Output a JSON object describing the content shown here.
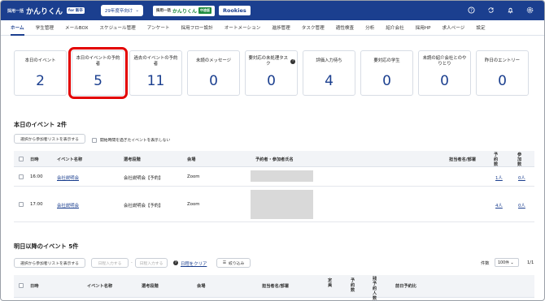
{
  "header": {
    "logo_prefix": "採用一括",
    "logo_name": "かんりくん",
    "logo_badge": "for 新卒",
    "year_selector": "29年度卒向け",
    "brand2_prefix": "採用一括",
    "brand2_name": "かんりくん",
    "brand2_badge": "中途版",
    "brand3": "Rookies",
    "icons": [
      "help-icon",
      "sync-icon",
      "bell-icon",
      "settings-icon"
    ]
  },
  "nav": {
    "items": [
      "ホーム",
      "学生管理",
      "メールBOX",
      "スケジュール管理",
      "アンケート",
      "採用フロー設計",
      "オートメーション",
      "進捗管理",
      "タスク管理",
      "適性検査",
      "分析",
      "紹介会社",
      "採用HP",
      "求人ページ",
      "設定"
    ],
    "active": "ホーム"
  },
  "cards": [
    {
      "label": "本日のイベント",
      "value": "2"
    },
    {
      "label": "本日のイベントの予約者",
      "value": "5"
    },
    {
      "label": "過去のイベントの予約者",
      "value": "11"
    },
    {
      "label": "未読のメッセージ",
      "value": "0"
    },
    {
      "label": "要対応の未処理タスク",
      "value": "0"
    },
    {
      "label": "評価入力待ち",
      "value": "4"
    },
    {
      "label": "要対応の学生",
      "value": "0"
    },
    {
      "label": "未読の紹介会社とのやりとり",
      "value": "0"
    },
    {
      "label": "昨日のエントリー",
      "value": "0"
    }
  ],
  "today": {
    "title": "本日のイベント 2件",
    "show_list_button": "選択から参加者リストを表示する",
    "hide_past_label": "開始時間を過ぎたイベントを表示しない",
    "columns": [
      "日時",
      "イベント名称",
      "選考段階",
      "会場",
      "予約者・参加者氏名",
      "担当者名/部署",
      "予約数",
      "参加数"
    ],
    "rows": [
      {
        "time": "16:00",
        "event": "会社説明会",
        "stage": "会社説明会【予約】",
        "venue": "Zoom",
        "reserved": "1人",
        "attended": "0人"
      },
      {
        "time": "17:00",
        "event": "会社説明会",
        "stage": "会社説明会【予約】",
        "venue": "Zoom",
        "reserved": "4人",
        "attended": "0人"
      }
    ]
  },
  "upcoming": {
    "title": "明日以降のイベント 5件",
    "show_list_button": "選択から参加者リストを表示する",
    "date_from_placeholder": "日程入力する",
    "date_to_placeholder": "日程入力する",
    "clear_label": "日程をクリア",
    "filter_label": "絞り込み",
    "count_label": "件数",
    "per_page": "100件",
    "page": "1/1",
    "columns": [
      "日時",
      "イベント名称",
      "選考段階",
      "会場",
      "担当者名/部署",
      "定員",
      "予約数",
      "残予約人数",
      "前日予約比"
    ]
  }
}
